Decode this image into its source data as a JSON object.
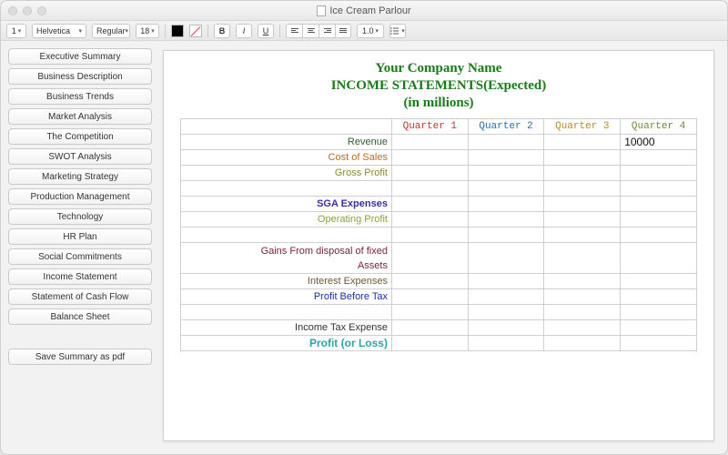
{
  "window": {
    "title": "Ice Cream Parlour"
  },
  "toolbar": {
    "style": "1",
    "font": "Helvetica",
    "weight": "Regular",
    "size": "18",
    "spacing": "1.0"
  },
  "sidebar": {
    "items": [
      "Executive Summary",
      "Business Description",
      "Business Trends",
      "Market Analysis",
      "The Competition",
      "SWOT Analysis",
      "Marketing Strategy",
      "Production Management",
      "Technology",
      "HR Plan",
      "Social Commitments",
      "Income Statement",
      "Statement of Cash Flow",
      "Balance Sheet"
    ],
    "save_pdf": "Save Summary as pdf"
  },
  "heading": {
    "line1": "Your Company Name",
    "line2": "INCOME STATEMENTS(Expected)",
    "line3": "(in millions)"
  },
  "columns": {
    "q1": "Quarter 1",
    "q2": "Quarter 2",
    "q3": "Quarter 3",
    "q4": "Quarter 4"
  },
  "rows": {
    "revenue": {
      "label": "Revenue",
      "q4": "10000"
    },
    "cost_of_sales": {
      "label": "Cost of Sales"
    },
    "gross_profit": {
      "label": "Gross Profit"
    },
    "blank1": {
      "label": ""
    },
    "sga": {
      "label": "SGA Expenses"
    },
    "operating_profit": {
      "label": "Operating Profit"
    },
    "blank2": {
      "label": ""
    },
    "gains_l1": {
      "label": "Gains From disposal of fixed"
    },
    "gains_l2": {
      "label": "Assets"
    },
    "interest": {
      "label": "Interest Expenses"
    },
    "pbt": {
      "label": "Profit Before Tax"
    },
    "blank3": {
      "label": ""
    },
    "tax": {
      "label": "Income Tax Expense"
    },
    "pl": {
      "label": "Profit (or Loss)"
    }
  },
  "chart_data": {
    "type": "table",
    "title": "INCOME STATEMENTS(Expected) (in millions)",
    "columns": [
      "Quarter 1",
      "Quarter 2",
      "Quarter 3",
      "Quarter 4"
    ],
    "rows": [
      {
        "label": "Revenue",
        "values": [
          null,
          null,
          null,
          10000
        ]
      },
      {
        "label": "Cost of Sales",
        "values": [
          null,
          null,
          null,
          null
        ]
      },
      {
        "label": "Gross Profit",
        "values": [
          null,
          null,
          null,
          null
        ]
      },
      {
        "label": "SGA Expenses",
        "values": [
          null,
          null,
          null,
          null
        ]
      },
      {
        "label": "Operating Profit",
        "values": [
          null,
          null,
          null,
          null
        ]
      },
      {
        "label": "Gains From disposal of fixed Assets",
        "values": [
          null,
          null,
          null,
          null
        ]
      },
      {
        "label": "Interest Expenses",
        "values": [
          null,
          null,
          null,
          null
        ]
      },
      {
        "label": "Profit Before Tax",
        "values": [
          null,
          null,
          null,
          null
        ]
      },
      {
        "label": "Income Tax Expense",
        "values": [
          null,
          null,
          null,
          null
        ]
      },
      {
        "label": "Profit (or Loss)",
        "values": [
          null,
          null,
          null,
          null
        ]
      }
    ]
  }
}
